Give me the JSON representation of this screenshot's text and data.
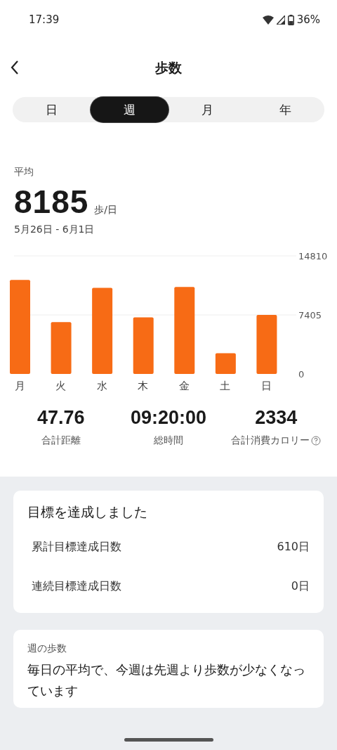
{
  "status_bar": {
    "time": "17:39",
    "battery": "36%"
  },
  "header": {
    "title": "歩数"
  },
  "tabs": [
    {
      "label": "日",
      "selected": false
    },
    {
      "label": "週",
      "selected": true
    },
    {
      "label": "月",
      "selected": false
    },
    {
      "label": "年",
      "selected": false
    }
  ],
  "summary": {
    "label": "平均",
    "value": "8185",
    "unit": "歩/日",
    "range": "5月26日 - 6月1日"
  },
  "chart_data": {
    "type": "bar",
    "categories": [
      "月",
      "火",
      "水",
      "木",
      "金",
      "土",
      "日"
    ],
    "series": [
      {
        "color": "#f76b15",
        "values": [
          11800,
          6500,
          10800,
          7100,
          10900,
          2600,
          7400
        ]
      }
    ],
    "ylim": [
      0,
      14810
    ],
    "yticks": [
      0,
      7405,
      14810
    ]
  },
  "stats": [
    {
      "value": "47.76",
      "label": "合計距離",
      "help": false
    },
    {
      "value": "09:20:00",
      "label": "総時間",
      "help": false
    },
    {
      "value": "2334",
      "label": "合計消費カロリー",
      "help": true
    }
  ],
  "goal_card": {
    "title": "目標を達成しました",
    "rows": [
      {
        "label": "累計目標達成日数",
        "value": "610日"
      },
      {
        "label": "連続目標達成日数",
        "value": "0日"
      }
    ]
  },
  "week_card": {
    "title": "週の歩数",
    "text": "毎日の平均で、今週は先週より歩数が少なくなっています"
  }
}
